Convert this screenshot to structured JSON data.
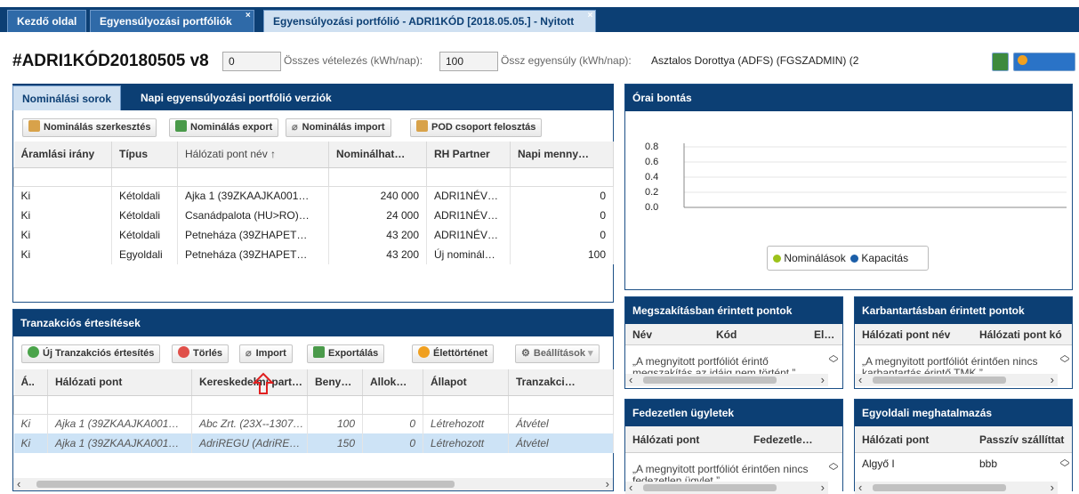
{
  "tabs": [
    {
      "label": "Kezdő oldal"
    },
    {
      "label": "Egyensúlyozási portfóliók"
    },
    {
      "label": "Egyensúlyozási portfólió - ADRI1KÓD [2018.05.05.] - Nyitott"
    }
  ],
  "header": {
    "title": "#ADRI1KÓD20180505 v8",
    "field1_value": "0",
    "total_purchase_label": "Összes vételezés (kWh/nap):",
    "total_purchase_value": "100",
    "total_balance_label": "Össz egyensúly (kWh/nap):",
    "user": "Asztalos Dorottya (ADFS) (FGSZADMIN) (2",
    "history_button": "Élettörténet"
  },
  "nomination_panel": {
    "tabs": [
      "Nominálási sorok",
      "Napi egyensúlyozási portfólió verziók"
    ],
    "toolbar": [
      "Nominálás szerkesztés",
      "Nominálás export",
      "Nominálás import",
      "POD csoport felosztás"
    ],
    "columns": [
      "Áramlási irány",
      "Típus",
      "Hálózati pont név ↑",
      "Nominálhat…",
      "RH Partner",
      "Napi menny…"
    ],
    "rows": [
      [
        "Ki",
        "Kétoldali",
        "Ajka 1 (39ZKAAJKA001…",
        "240 000",
        "ADRI1NÉV…",
        "0"
      ],
      [
        "Ki",
        "Kétoldali",
        "Csanádpalota (HU>RO)…",
        "24 000",
        "ADRI1NÉV…",
        "0"
      ],
      [
        "Ki",
        "Kétoldali",
        "Petneháza (39ZHAPET…",
        "43 200",
        "ADRI1NÉV…",
        "0"
      ],
      [
        "Ki",
        "Egyoldali",
        "Petneháza (39ZHAPET…",
        "43 200",
        "Új nominál…",
        "100"
      ]
    ]
  },
  "hourly_panel": {
    "title": "Órai bontás",
    "y_ticks": [
      "0.8",
      "0.6",
      "0.4",
      "0.2",
      "0.0"
    ],
    "legend": [
      "Nominálások",
      "Kapacitás"
    ],
    "legend_colors": [
      "#9cc21b",
      "#1b5ea8"
    ]
  },
  "transactions_panel": {
    "title": "Tranzakciós értesítések",
    "toolbar": [
      "Új Tranzakciós értesítés",
      "Törlés",
      "Import",
      "Exportálás",
      "Élettörténet",
      "Beállítások"
    ],
    "columns": [
      "Á..",
      "Hálózati pont",
      "Kereskedelmi part…",
      "Beny…",
      "Allok…",
      "Állapot",
      "Tranzakci…"
    ],
    "rows": [
      [
        "Ki",
        "Ajka 1 (39ZKAAJKA001…",
        "Abc Zrt. (23X--1307…",
        "100",
        "0",
        "Létrehozott",
        "Átvétel"
      ],
      [
        "Ki",
        "Ajka 1 (39ZKAAJKA001…",
        "AdriREGU (AdriRE…",
        "150",
        "0",
        "Létrehozott",
        "Átvétel"
      ]
    ]
  },
  "interruption_panel": {
    "title": "Megszakításban érintett pontok",
    "columns": [
      "Név",
      "Kód",
      "El…"
    ],
    "message": "„A megnyitott portfóliót érintő megszakítás az idáig nem történt.”"
  },
  "maintenance_panel": {
    "title": "Karbantartásban érintett pontok",
    "columns": [
      "Hálózati pont név",
      "Hálózati pont kó"
    ],
    "message": "„A megnyitott portfóliót érintően nincs karbantartás érintő TMK.”"
  },
  "uncovered_panel": {
    "title": "Fedezetlen ügyletek",
    "columns": [
      "Hálózati pont",
      "Fedezetle…"
    ],
    "message": "„A megnyitott portfóliót érintően nincs fedezetlen ügylet.”"
  },
  "unilateral_panel": {
    "title": "Egyoldali meghatalmazás",
    "columns": [
      "Hálózati pont",
      "Passzív szállíttat"
    ],
    "rows": [
      [
        "Algyő I",
        "bbb"
      ]
    ]
  }
}
